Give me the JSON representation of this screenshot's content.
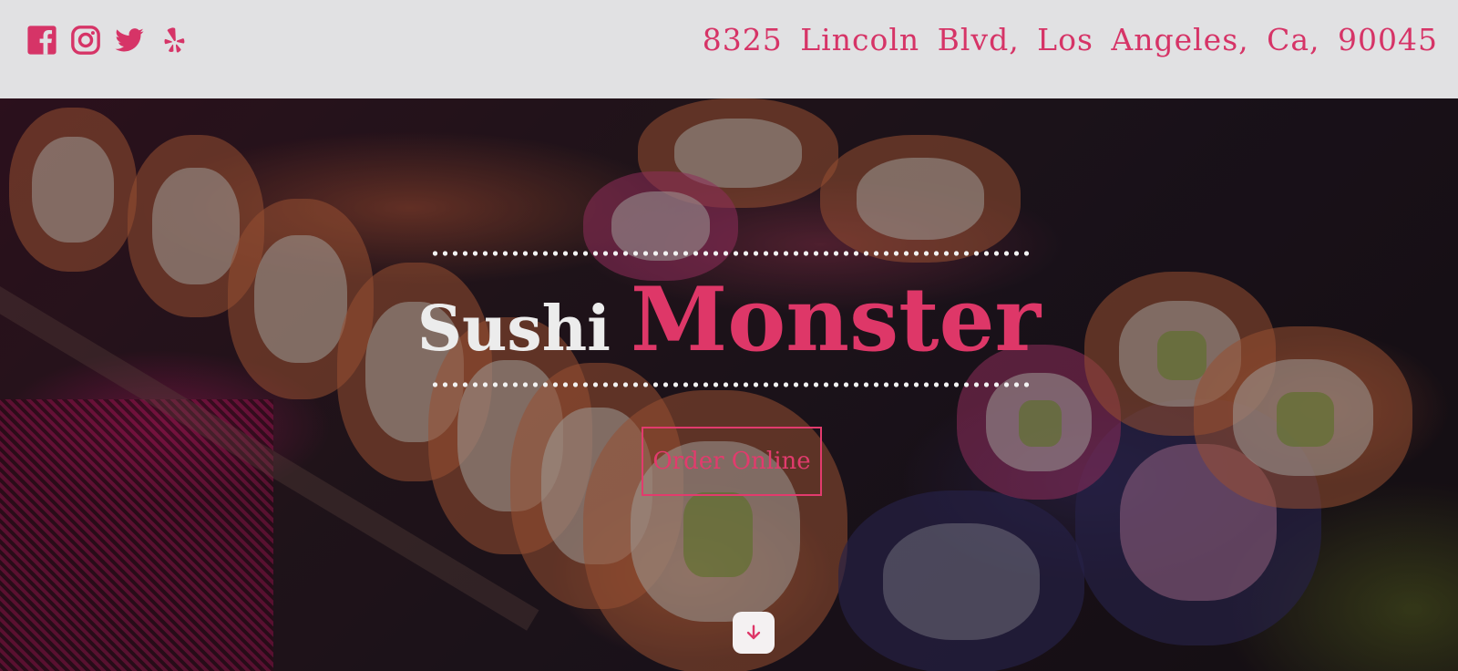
{
  "header": {
    "social_icons": [
      "facebook-icon",
      "instagram-icon",
      "twitter-icon",
      "yelp-icon"
    ],
    "address": "8325 Lincoln Blvd, Los Angeles, Ca, 90045"
  },
  "hero": {
    "title_part1": "Sushi",
    "title_part2": "Monster",
    "order_button": "Order Online",
    "scroll_icon": "arrow-down-icon"
  },
  "colors": {
    "accent": "#de3768",
    "header_bg": "#e1e1e3",
    "title_light": "#ececec"
  }
}
